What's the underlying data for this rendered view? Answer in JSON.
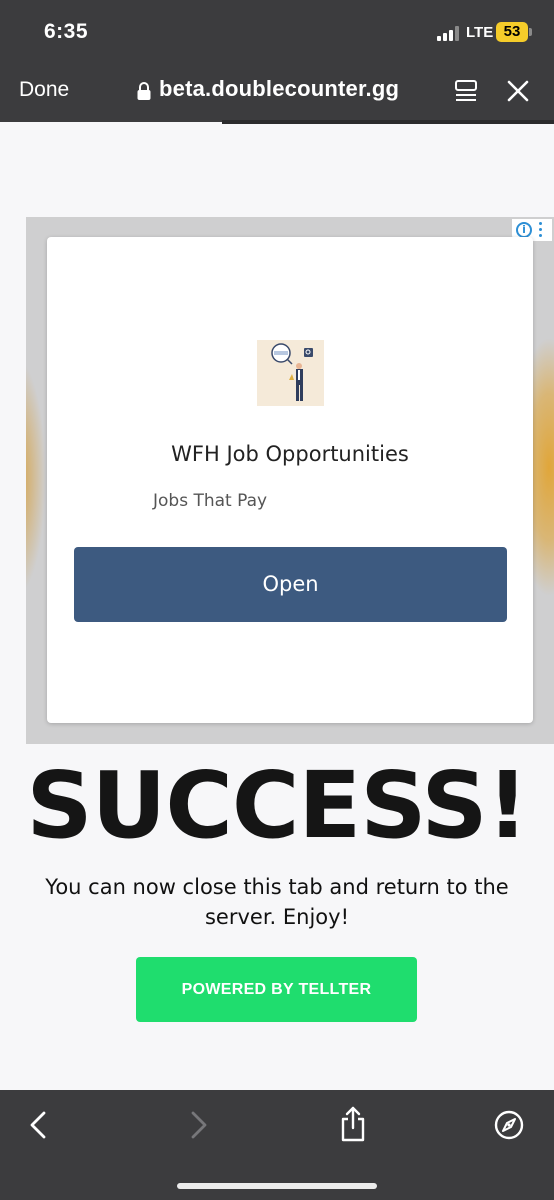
{
  "status_bar": {
    "time": "6:35",
    "network": "LTE",
    "battery": "53",
    "battery_color": "#f5cc2a"
  },
  "browser": {
    "done_label": "Done",
    "url": "beta.doublecounter.gg",
    "icons": [
      "lock-icon",
      "reader-icon",
      "close-icon"
    ]
  },
  "ad": {
    "title": "WFH Job Opportunities",
    "subtitle": "Jobs That Pay",
    "cta": "Open",
    "cta_color": "#3d5a80",
    "adchoices_icons": [
      "info-icon",
      "more-icon"
    ]
  },
  "page": {
    "heading": "SUCCESS!",
    "message": "You can now close this tab and return to the server. Enjoy!",
    "powered_by": "POWERED BY TELLTER",
    "powered_color": "#1fdd6e"
  },
  "toolbar": {
    "icons": [
      "back-icon",
      "forward-icon",
      "share-icon",
      "safari-compass-icon"
    ]
  }
}
